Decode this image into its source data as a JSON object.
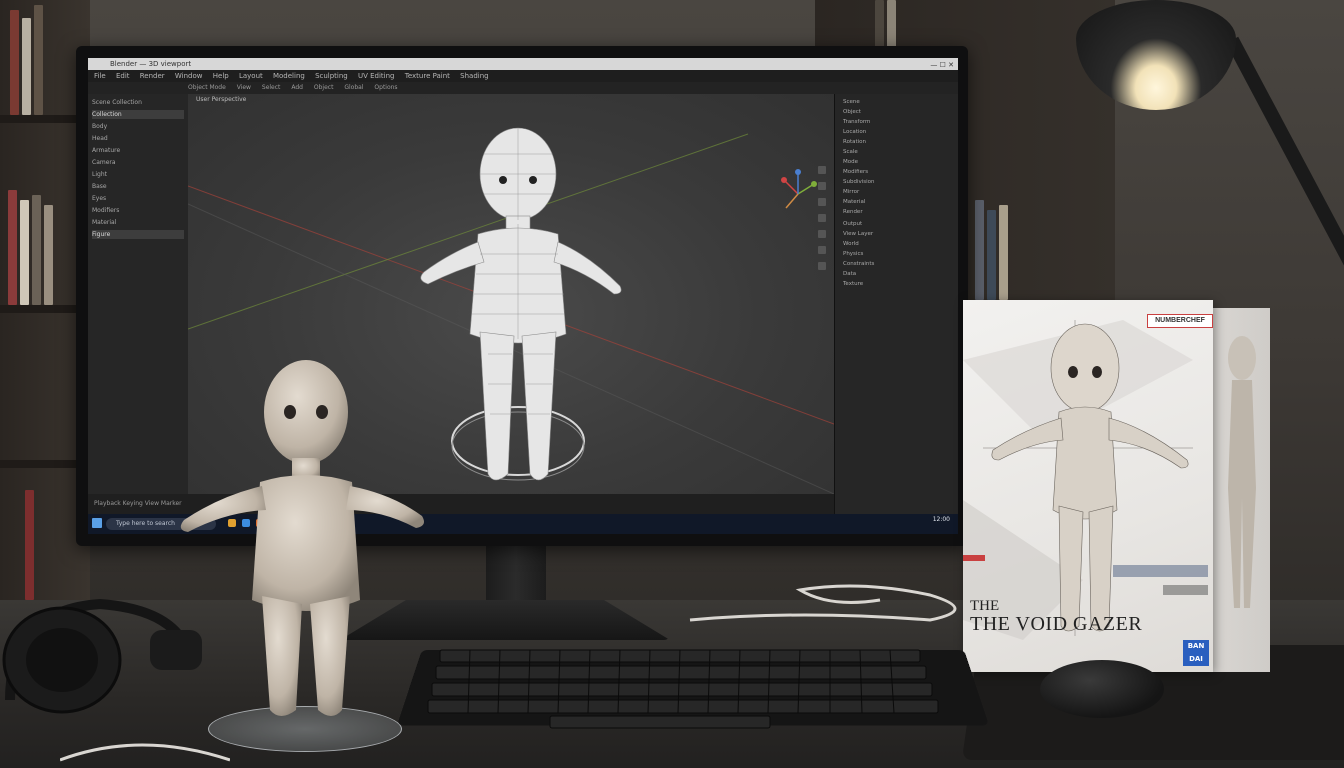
{
  "monitor": {
    "title_bar_text": "Blender — 3D viewport",
    "window_controls": "— ☐ ✕",
    "menu_items": [
      "File",
      "Edit",
      "Render",
      "Window",
      "Help",
      "Layout",
      "Modeling",
      "Sculpting",
      "UV Editing",
      "Texture Paint",
      "Shading"
    ],
    "header_items": [
      "Object Mode",
      "View",
      "Select",
      "Add",
      "Object",
      "Global",
      "Options"
    ],
    "viewport_label": "User Perspective",
    "outliner_items": [
      "Scene Collection",
      "Collection",
      "Body",
      "Head",
      "Armature",
      "Camera",
      "Light",
      "Base",
      "Eyes",
      "Modifiers",
      "Material",
      "Figure"
    ],
    "properties_items": [
      "Scene",
      "Object",
      "Transform",
      "Location",
      "Rotation",
      "Scale",
      "Mode",
      "Modifiers",
      "Subdivision",
      "Mirror",
      "Material",
      "Render",
      "Output",
      "View Layer",
      "World",
      "Physics",
      "Constraints",
      "Data",
      "Texture"
    ],
    "timeline_text": "Playback  Keying  View  Marker",
    "taskbar_search": "Type here to search",
    "tray_time": "12:00"
  },
  "product_box": {
    "brand": "NUMBERCHEF",
    "title_line1": "THE",
    "title_line2": "THE VOID GAZER",
    "logo_text": "BAN DAI"
  },
  "colors": {
    "box_stripe_red": "#c94040",
    "box_stripe_blue": "#2a5fbf",
    "viewport_bg": "#3a3a3a",
    "taskbar_bg": "#101828"
  }
}
